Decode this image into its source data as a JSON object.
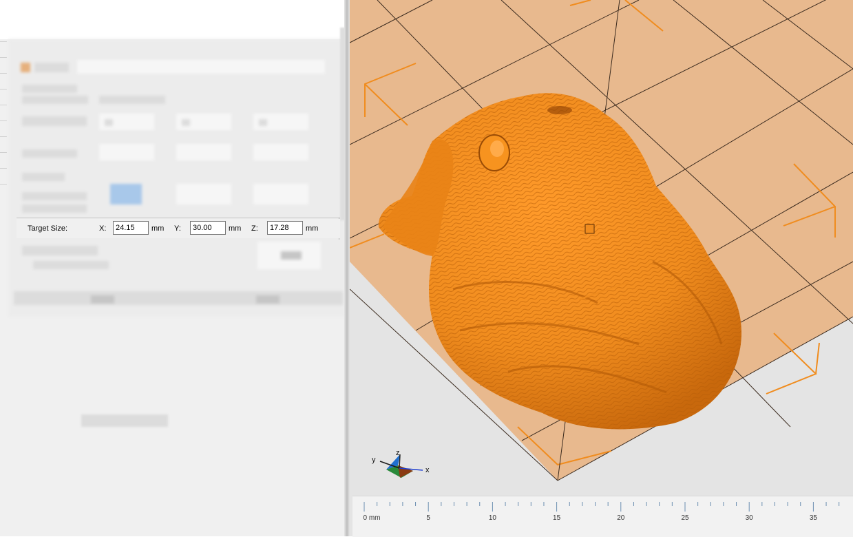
{
  "target_size": {
    "label": "Target Size:",
    "x_label": "X:",
    "x_value": "24.15",
    "y_label": "Y:",
    "y_value": "30.00",
    "z_label": "Z:",
    "z_value": "17.28",
    "unit": "mm"
  },
  "axis_triad": {
    "x_label": "x",
    "y_label": "y",
    "z_label": "z"
  },
  "ruler": {
    "ticks": [
      "0 mm",
      "5",
      "10",
      "15",
      "20",
      "25",
      "30",
      "35"
    ]
  },
  "colors": {
    "model": "#f08c1e",
    "bed": "#e8b98e",
    "bed_grid": "#3a2a1e",
    "bounding_box": "#f08c1e"
  }
}
